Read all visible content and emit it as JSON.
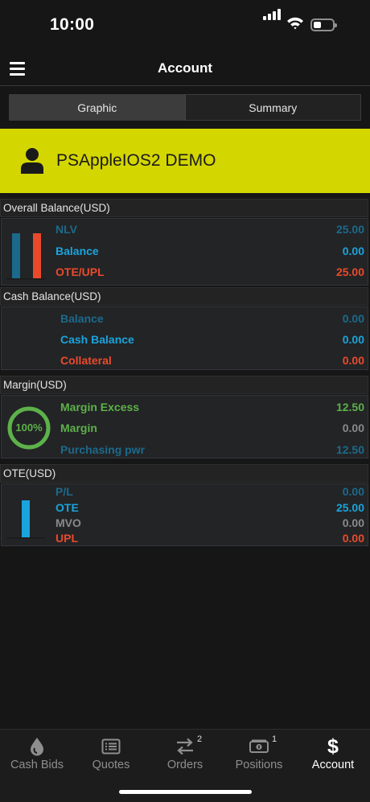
{
  "status_bar": {
    "time": "10:00"
  },
  "header": {
    "title": "Account"
  },
  "tabs": [
    {
      "label": "Graphic",
      "active": true
    },
    {
      "label": "Summary",
      "active": false
    }
  ],
  "account": {
    "name": "PSAppleIOS2 DEMO",
    "banner_color": "#d4d600"
  },
  "overall_balance": {
    "title": "Overall Balance(USD)",
    "chart": [
      25.0,
      0.0,
      25.0
    ],
    "rows": [
      {
        "label": "NLV",
        "value": "25.00",
        "color": "#1b6a8c"
      },
      {
        "label": "Balance",
        "value": "0.00",
        "color": "#19a4dc"
      },
      {
        "label": "OTE/UPL",
        "value": "25.00",
        "color": "#ea4a2b"
      }
    ]
  },
  "cash_balance": {
    "title": "Cash Balance(USD)",
    "rows": [
      {
        "label": "Balance",
        "value": "0.00",
        "color": "#1b6a8c"
      },
      {
        "label": "Cash Balance",
        "value": "0.00",
        "color": "#19a4dc"
      },
      {
        "label": "Collateral",
        "value": "0.00",
        "color": "#ea4a2b"
      }
    ]
  },
  "margin": {
    "title": "Margin(USD)",
    "gauge_label": "100%",
    "gauge_fraction": 1.0,
    "rows": [
      {
        "label": "Margin Excess",
        "value": "12.50",
        "color": "#5db14a"
      },
      {
        "label": "Margin",
        "value": "0.00",
        "color": "#5db14a"
      },
      {
        "label": "Purchasing pwr",
        "value": "12.50",
        "color": "#1b6a8c"
      }
    ]
  },
  "ote": {
    "title": "OTE(USD)",
    "chart": [
      25.0
    ],
    "rows": [
      {
        "label": "P/L",
        "value": "0.00",
        "color": "#1b6a8c"
      },
      {
        "label": "OTE",
        "value": "25.00",
        "color": "#19a4dc"
      },
      {
        "label": "MVO",
        "value": "0.00",
        "color": "#8a8a8a"
      },
      {
        "label": "UPL",
        "value": "0.00",
        "color": "#ea4a2b"
      }
    ]
  },
  "tabbar": [
    {
      "label": "Cash Bids",
      "icon": "drop-icon",
      "active": false,
      "badge": ""
    },
    {
      "label": "Quotes",
      "icon": "list-icon",
      "active": false,
      "badge": ""
    },
    {
      "label": "Orders",
      "icon": "swap-arrows-icon",
      "active": false,
      "badge": "2"
    },
    {
      "label": "Positions",
      "icon": "money-icon",
      "active": false,
      "badge": "1"
    },
    {
      "label": "Account",
      "icon": "dollar-icon",
      "active": true,
      "badge": ""
    }
  ]
}
